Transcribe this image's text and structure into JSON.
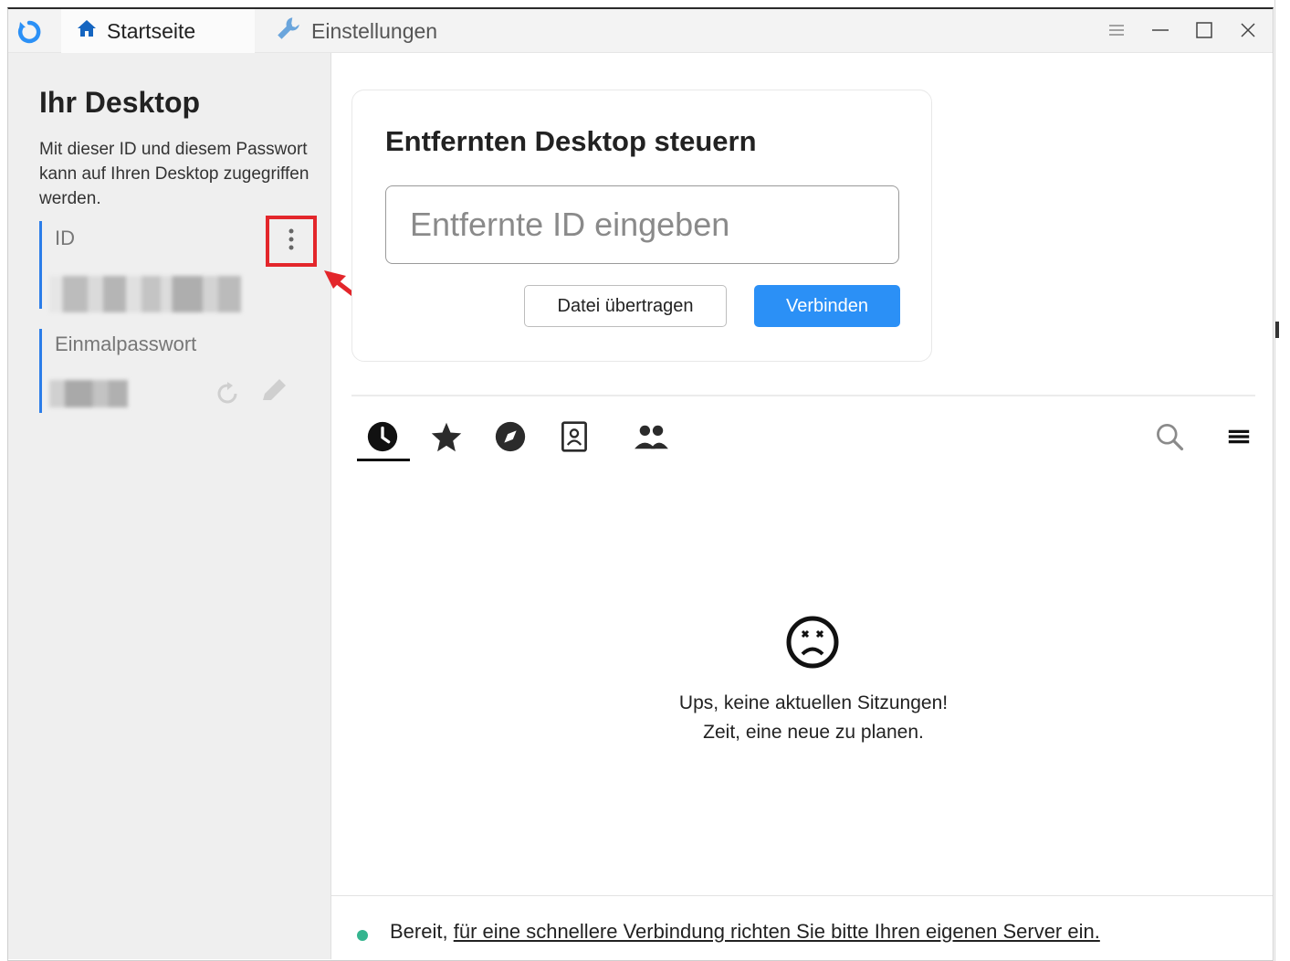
{
  "tabs": [
    {
      "label": "Startseite",
      "icon": "home-icon",
      "active": true
    },
    {
      "label": "Einstellungen",
      "icon": "wrench-icon",
      "active": false
    }
  ],
  "left": {
    "title": "Ihr Desktop",
    "description": "Mit dieser ID und diesem Passwort kann auf Ihren Desktop zugegriffen werden.",
    "id_label": "ID",
    "password_label": "Einmalpasswort"
  },
  "connect": {
    "title": "Entfernten Desktop steuern",
    "placeholder": "Entfernte ID eingeben",
    "transfer_label": "Datei übertragen",
    "connect_label": "Verbinden"
  },
  "sessions": {
    "tab_icons": [
      "recent-clock-icon",
      "favorites-star-icon",
      "discovered-compass-icon",
      "address-book-icon",
      "group-icon"
    ],
    "empty_line1": "Ups, keine aktuellen Sitzungen!",
    "empty_line2": "Zeit, eine neue zu planen."
  },
  "status": {
    "text": "Bereit,",
    "link": "für eine schnellere Verbindung richten Sie bitte Ihren eigenen Server ein.",
    "color": "#35b58f"
  },
  "colors": {
    "accent": "#2b90f6",
    "highlight": "#e3262b"
  }
}
